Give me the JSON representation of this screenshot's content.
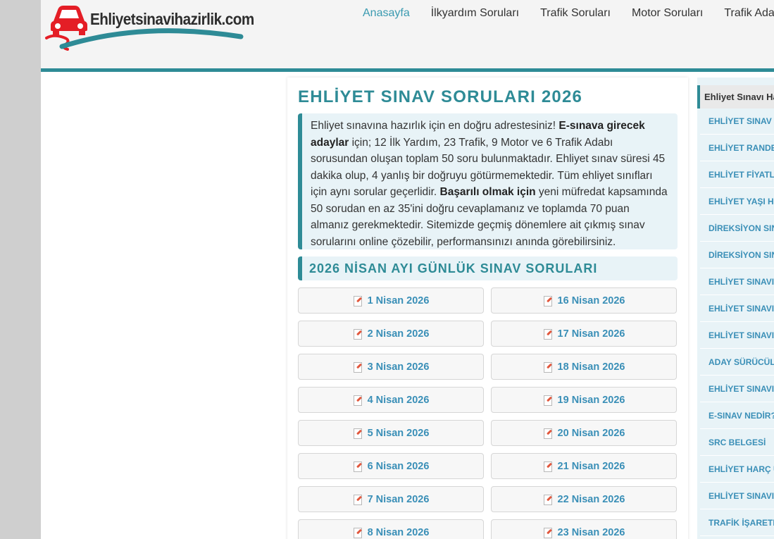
{
  "site": {
    "logo_text": "Ehliyetsinavihazirlik.com"
  },
  "nav": [
    {
      "label": "Anasayfa",
      "active": true
    },
    {
      "label": "İlkyardım Soruları",
      "active": false
    },
    {
      "label": "Trafik Soruları",
      "active": false
    },
    {
      "label": "Motor Soruları",
      "active": false
    },
    {
      "label": "Trafik Adabı",
      "active": false
    }
  ],
  "main": {
    "title": "EHLİYET SINAV SORULARI 2026",
    "intro": {
      "t1": "Ehliyet sınavına hazırlık için en doğru adrestesiniz! ",
      "b1": "E-sınava girecek adaylar",
      "t2": " için; 12 İlk Yardım, 23 Trafik, 9 Motor ve 6 Trafik Adabı sorusundan oluşan toplam 50 soru bulunmaktadır. Ehliyet sınav süresi 45 dakika olup, 4 yanlış bir doğruyu götürmemektedir. Tüm ehliyet sınıfları için aynı sorular geçerlidir. ",
      "b2": "Başarılı olmak için",
      "t3": " yeni müfredat kapsamında 50 sorudan en az 35'ini doğru cevaplamanız ve toplamda 70 puan almanız gerekmektedir. Sitemizde geçmiş dönemlere ait çıkmış sınav sorularını online çözebilir, performansınızı anında görebilirsiniz."
    },
    "section_heading": "2026 NİSAN AYI GÜNLÜK SINAV SORULARI",
    "days_left": [
      "1 Nisan 2026",
      "2 Nisan 2026",
      "3 Nisan 2026",
      "4 Nisan 2026",
      "5 Nisan 2026",
      "6 Nisan 2026",
      "7 Nisan 2026",
      "8 Nisan 2026"
    ],
    "days_right": [
      "16 Nisan 2026",
      "17 Nisan 2026",
      "18 Nisan 2026",
      "19 Nisan 2026",
      "20 Nisan 2026",
      "21 Nisan 2026",
      "22 Nisan 2026",
      "23 Nisan 2026"
    ]
  },
  "sidebar": {
    "heading": "Ehliyet Sınavı Hakkında",
    "items": [
      "EHLİYET SINAV TARİHLERİ",
      "EHLİYET RANDEVU ALMA",
      "EHLİYET FİYATLARI",
      "EHLİYET YAŞI HESAPLAMA",
      "DİREKSİYON SINAVI",
      "DİREKSİYON SINAVI PUANLAMA",
      "EHLİYET SINAVINDA KOPYA",
      "EHLİYET SINAVINDA KAÇ YANLIŞ",
      "EHLİYET SINAVI BAŞARI",
      "ADAY SÜRÜCÜLÜK BELGESİ",
      "EHLİYET SINAVI ÜCRETİ",
      "E-SINAV NEDİR?",
      "SRC BELGESİ",
      "EHLİYET HARÇ ÜCRETİ",
      "EHLİYET SINAVI SONUÇLARI",
      "TRAFİK İŞARETLERİ"
    ]
  }
}
